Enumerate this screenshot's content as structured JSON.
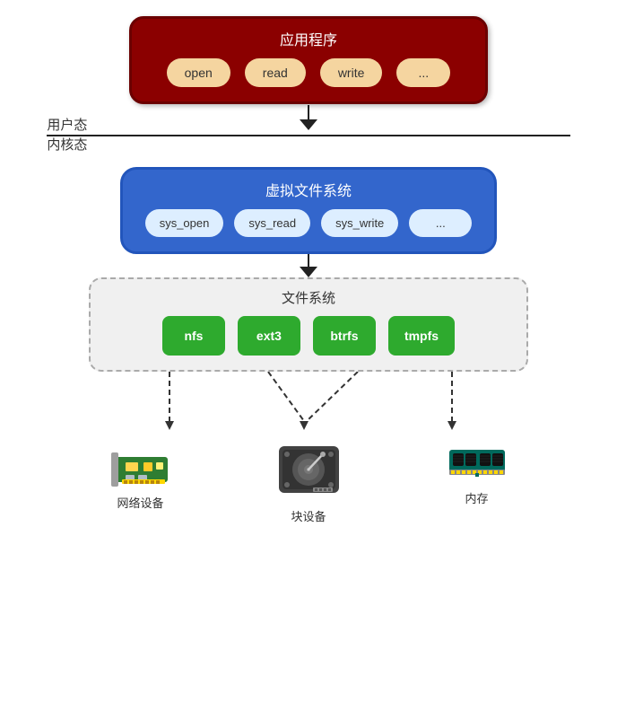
{
  "app": {
    "title": "应用程序",
    "buttons": [
      "open",
      "read",
      "write",
      "..."
    ]
  },
  "zones": {
    "user": "用户态",
    "kernel": "内核态"
  },
  "vfs": {
    "title": "虚拟文件系统",
    "buttons": [
      "sys_open",
      "sys_read",
      "sys_write",
      "..."
    ]
  },
  "fs": {
    "title": "文件系统",
    "buttons": [
      "nfs",
      "ext3",
      "btrfs",
      "tmpfs"
    ]
  },
  "devices": [
    {
      "label": "网络设备",
      "type": "network"
    },
    {
      "label": "块设备",
      "type": "hdd"
    },
    {
      "label": "内存",
      "type": "ram"
    }
  ]
}
